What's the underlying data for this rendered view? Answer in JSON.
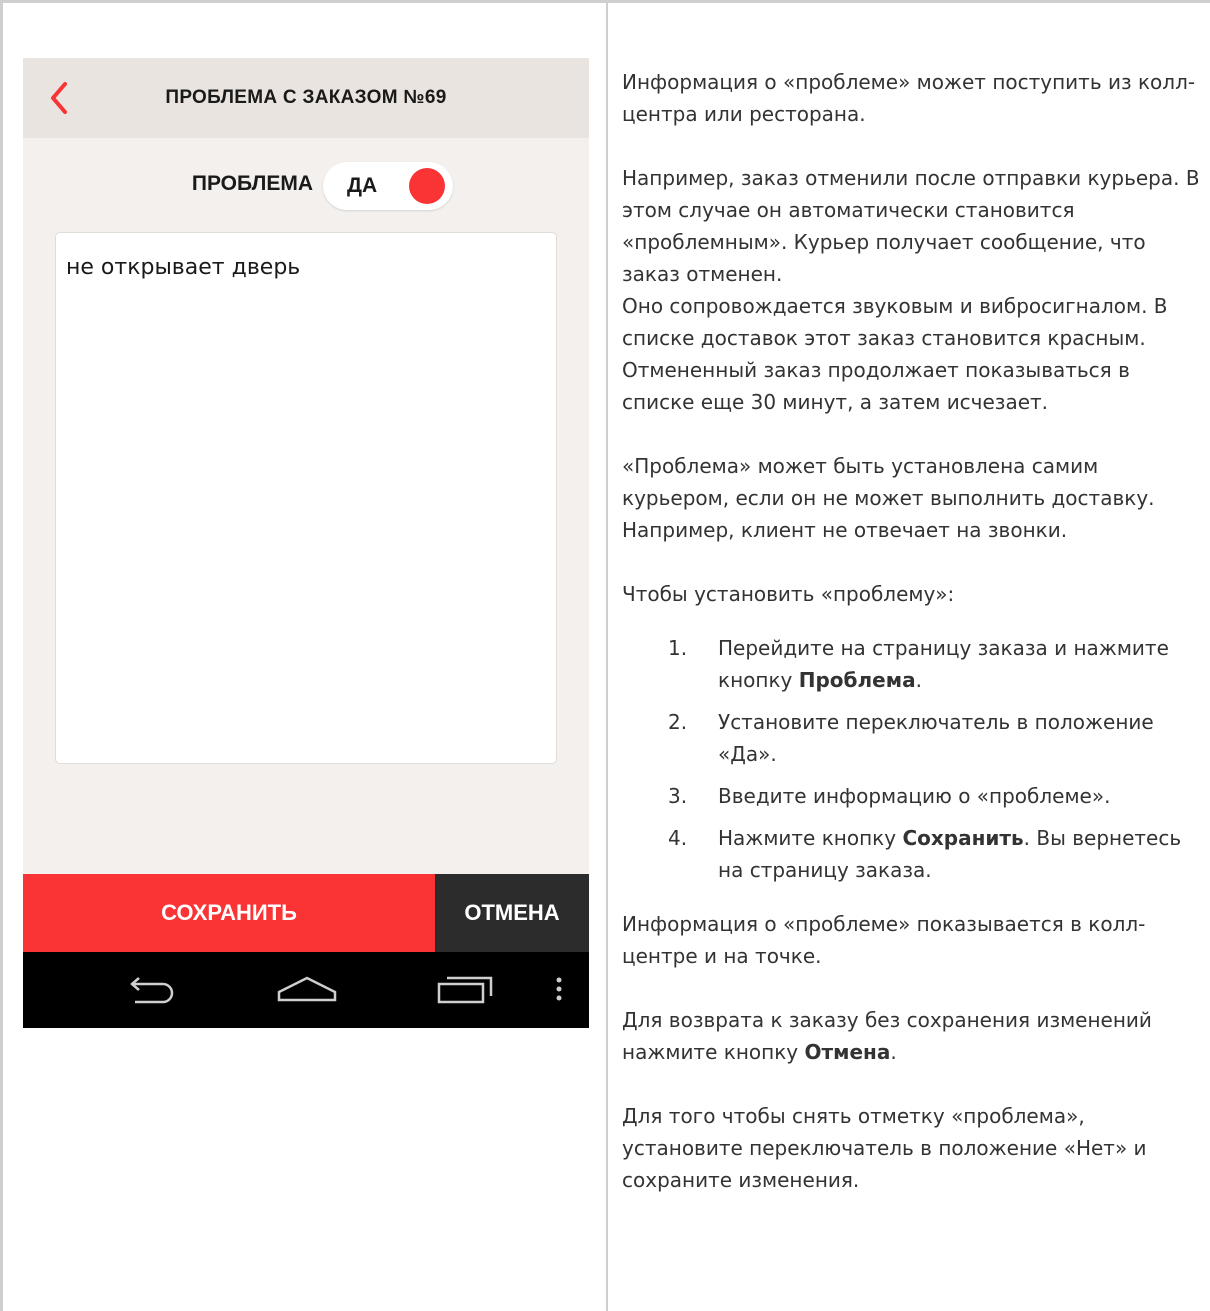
{
  "app": {
    "title": "ПРОБЛЕМА С ЗАКАЗОМ №69",
    "toggle_label": "ПРОБЛЕМА",
    "toggle_value": "ДА",
    "problem_text": "не открывает дверь",
    "save_label": "СОХРАНИТЬ",
    "cancel_label": "ОТМЕНА",
    "nav_icons": [
      "back-icon",
      "home-icon",
      "recent-apps-icon",
      "menu-icon"
    ],
    "colors": {
      "accent": "#fa3335",
      "header_bg": "#e9e4df",
      "screen_bg": "#f3f0ed",
      "cancel_bg": "#2c2c2c"
    }
  },
  "doc": {
    "p1": "Информация о «проблеме» может поступить из колл-центра или ресторана.",
    "p2a": "Например, заказ отменили после отправки курьера. В этом случае он автоматически становится «проблемным». Курьер получает сообщение, что заказ отменен.",
    "p2b": "Оно сопровождается звуковым и вибросигналом. В списке доставок этот заказ становится красным. Отмененный заказ продолжает показываться в списке еще 30 минут, а затем исчезает.",
    "p3": "«Проблема» может быть установлена самим курьером, если он не может выполнить доставку. Например, клиент не отвечает на звонки.",
    "p4": "Чтобы установить «проблему»:",
    "steps": [
      {
        "num": "1.",
        "text": "Перейдите на страницу заказа и нажмите кнопку ",
        "bold": "Проблема",
        "after": "."
      },
      {
        "num": "2.",
        "text": "Установите переключатель в положение «Да»."
      },
      {
        "num": "3.",
        "text": "Введите информацию о «проблеме»."
      },
      {
        "num": "4.",
        "text": "Нажмите кнопку ",
        "bold": "Сохранить",
        "after": ". Вы вернетесь на страницу заказа."
      }
    ],
    "p5": "Информация о «проблеме» показывается в колл-центре и на точке.",
    "p6_text": "Для возврата к заказу без сохранения изменений нажмите кнопку ",
    "p6_bold": "Отмена",
    "p6_after": ".",
    "p7": "Для того чтобы снять отметку «проблема», установите переключатель в положение «Нет» и сохраните изменения."
  }
}
